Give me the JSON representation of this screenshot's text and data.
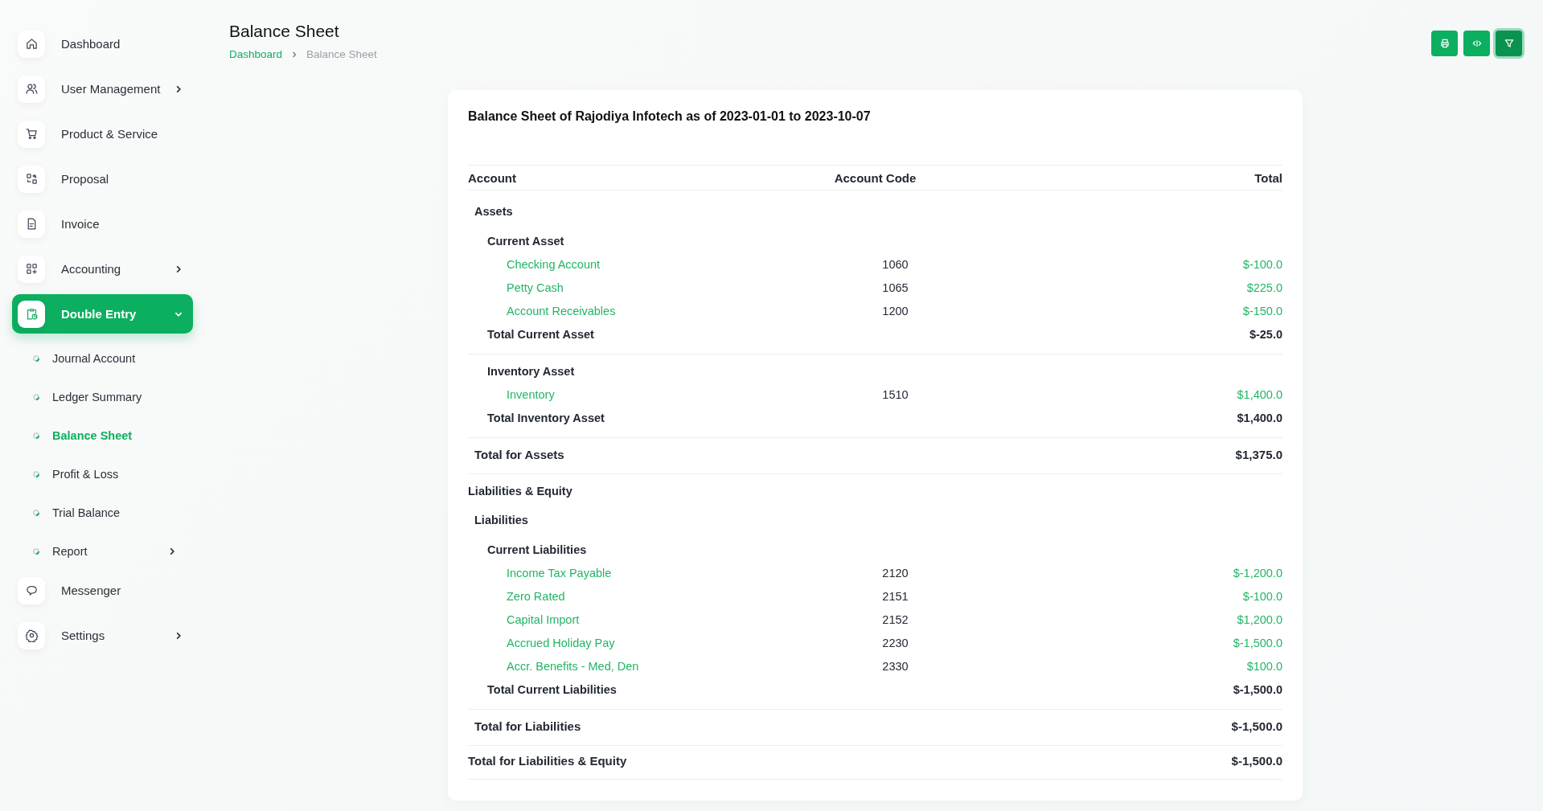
{
  "sidebar": {
    "items": [
      {
        "label": "Dashboard",
        "has_submenu": false,
        "selected": false
      },
      {
        "label": "User Management",
        "has_submenu": true,
        "selected": false,
        "expanded": false
      },
      {
        "label": "Product & Service",
        "has_submenu": false,
        "selected": false
      },
      {
        "label": "Proposal",
        "has_submenu": false,
        "selected": false
      },
      {
        "label": "Invoice",
        "has_submenu": false,
        "selected": false
      },
      {
        "label": "Accounting",
        "has_submenu": true,
        "selected": false,
        "expanded": false
      },
      {
        "label": "Double Entry",
        "has_submenu": true,
        "selected": true,
        "expanded": true,
        "children": [
          {
            "label": "Journal Account",
            "selected": false,
            "has_submenu": false
          },
          {
            "label": "Ledger Summary",
            "selected": false,
            "has_submenu": false
          },
          {
            "label": "Balance Sheet",
            "selected": true,
            "has_submenu": false
          },
          {
            "label": "Profit & Loss",
            "selected": false,
            "has_submenu": false
          },
          {
            "label": "Trial Balance",
            "selected": false,
            "has_submenu": false
          },
          {
            "label": "Report",
            "selected": false,
            "has_submenu": true
          }
        ]
      },
      {
        "label": "Messenger",
        "has_submenu": false,
        "selected": false
      },
      {
        "label": "Settings",
        "has_submenu": true,
        "selected": false,
        "expanded": false
      }
    ]
  },
  "header": {
    "title": "Balance Sheet",
    "breadcrumb": [
      {
        "label": "Dashboard",
        "link": true
      },
      {
        "label": "Balance Sheet",
        "link": false
      }
    ]
  },
  "toolbar": {
    "buttons": [
      {
        "focused": false
      },
      {
        "focused": false
      },
      {
        "focused": true
      }
    ]
  },
  "report": {
    "title": "Balance Sheet of Rajodiya Infotech as of 2023-01-01 to 2023-10-07",
    "columns": [
      "Account",
      "Account Code",
      "Total"
    ],
    "blocks": [
      {
        "kind": "section",
        "name": "Assets",
        "groups": [
          {
            "name": "Current Asset",
            "accounts": [
              {
                "name": "Checking Account",
                "code": "1060",
                "total": "$-100.0"
              },
              {
                "name": "Petty Cash",
                "code": "1065",
                "total": "$225.0"
              },
              {
                "name": "Account Receivables",
                "code": "1200",
                "total": "$-150.0"
              }
            ],
            "total_label": "Total Current Asset",
            "total": "$-25.0"
          },
          {
            "name": "Inventory Asset",
            "accounts": [
              {
                "name": "Inventory",
                "code": "1510",
                "total": "$1,400.0"
              }
            ],
            "total_label": "Total Inventory Asset",
            "total": "$1,400.0"
          }
        ],
        "total_label": "Total for Assets",
        "total": "$1,375.0"
      },
      {
        "kind": "category",
        "name": "Liabilities & Equity",
        "sections": [
          {
            "name": "Liabilities",
            "groups": [
              {
                "name": "Current Liabilities",
                "accounts": [
                  {
                    "name": "Income Tax Payable",
                    "code": "2120",
                    "total": "$-1,200.0"
                  },
                  {
                    "name": "Zero Rated",
                    "code": "2151",
                    "total": "$-100.0"
                  },
                  {
                    "name": "Capital Import",
                    "code": "2152",
                    "total": "$1,200.0"
                  },
                  {
                    "name": "Accrued Holiday Pay",
                    "code": "2230",
                    "total": "$-1,500.0"
                  },
                  {
                    "name": "Accr. Benefits - Med, Den",
                    "code": "2330",
                    "total": "$100.0"
                  }
                ],
                "total_label": "Total Current Liabilities",
                "total": "$-1,500.0"
              }
            ],
            "total_label": "Total for Liabilities",
            "total": "$-1,500.0"
          }
        ],
        "total_label": "Total for Liabilities & Equity",
        "total": "$-1,500.0"
      }
    ]
  }
}
